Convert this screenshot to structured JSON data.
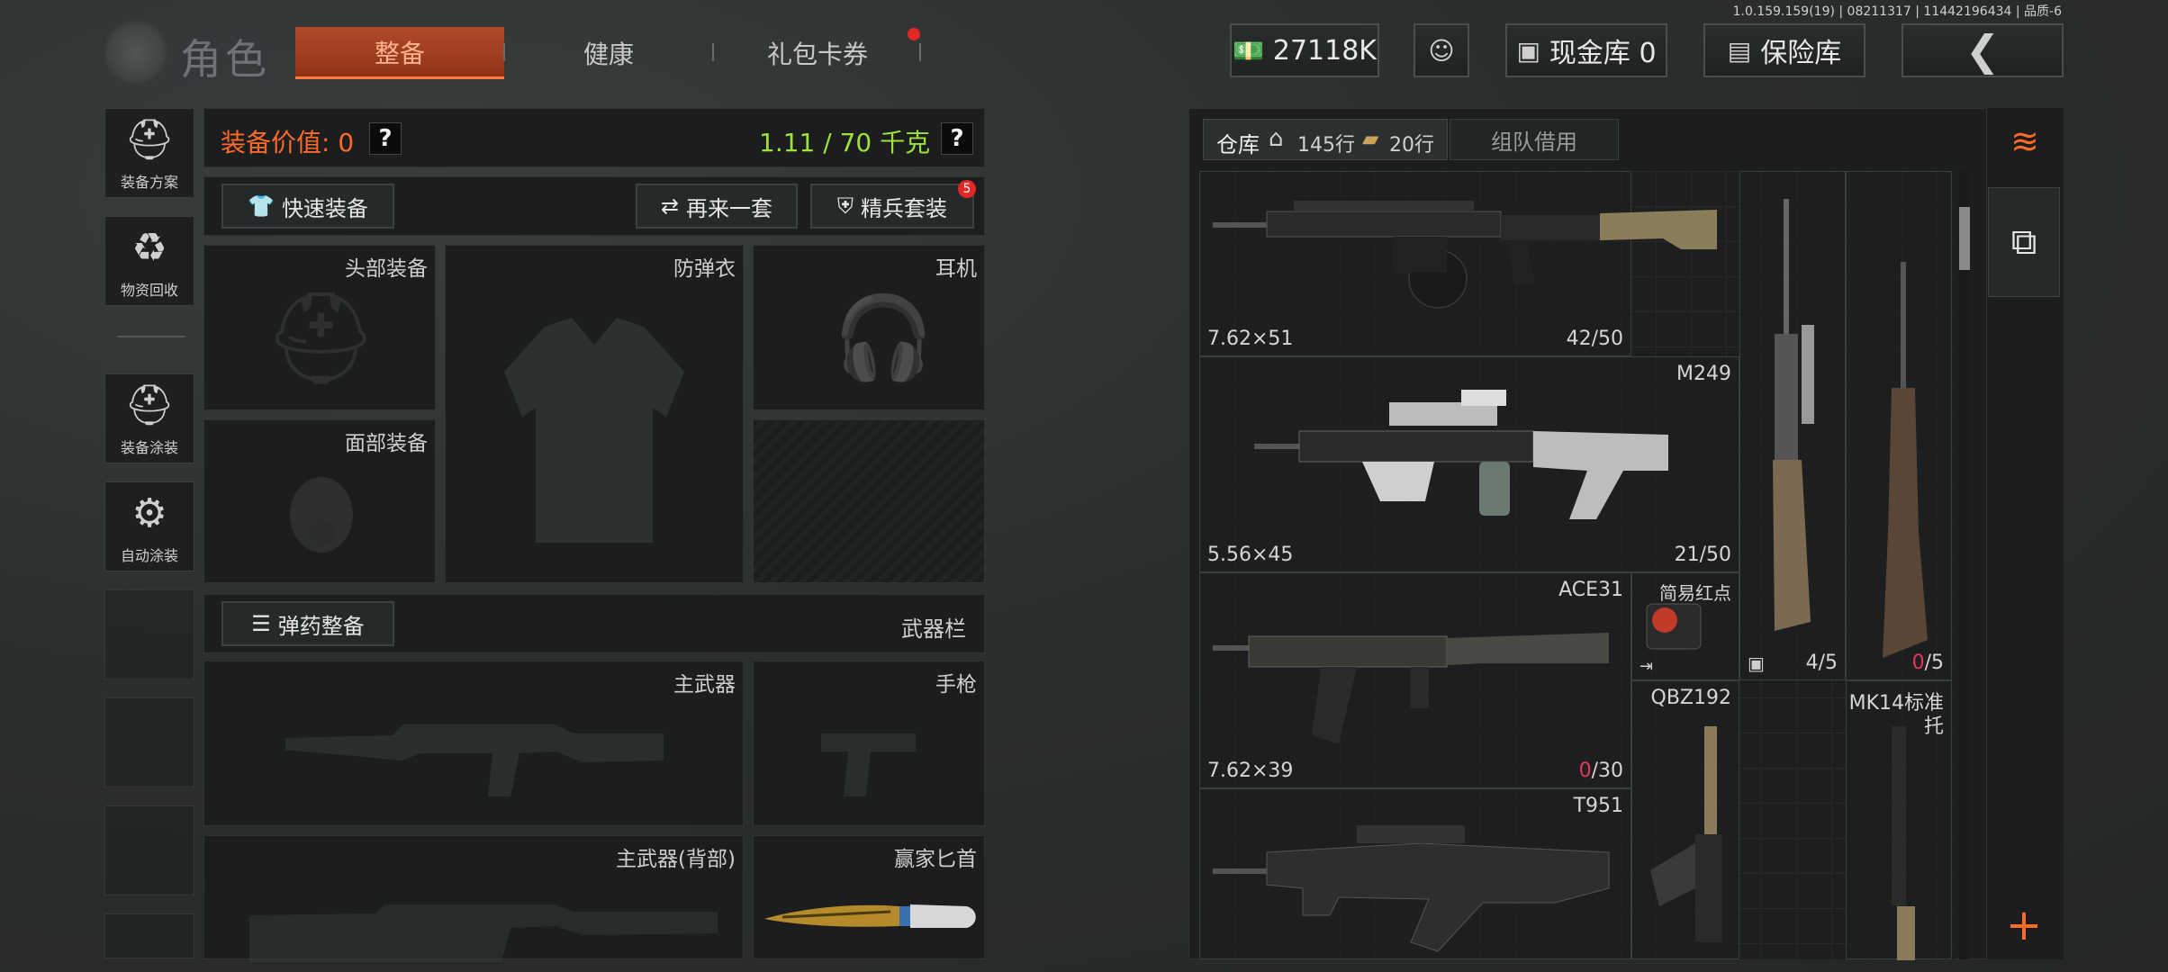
{
  "version": "1.0.159.159(19) | 08211317 | 11442196434 | 品质-6",
  "header": {
    "title": "角色",
    "tabs": [
      {
        "label": "整备",
        "active": true
      },
      {
        "label": "健康",
        "active": false
      },
      {
        "label": "礼包卡券",
        "active": false,
        "notification": true
      }
    ],
    "currency": "27118K",
    "cash_vault": "现金库 0",
    "safe_box": "保险库"
  },
  "sidebar": {
    "items": [
      {
        "label": "装备方案",
        "icon": "helmet-plan-icon"
      },
      {
        "label": "物资回收",
        "icon": "recycle-icon"
      },
      {
        "label": "装备涂装",
        "icon": "paint-armor-icon"
      },
      {
        "label": "自动涂装",
        "icon": "auto-paint-icon"
      }
    ]
  },
  "equipment": {
    "value_label": "装备价值: 0",
    "weight": "1.11 / 70 千克",
    "help": "?",
    "quick_equip": "快速装备",
    "again": "再来一套",
    "elite_set": "精兵套装",
    "elite_badge": "5",
    "slots": {
      "head": "头部装备",
      "armor": "防弹衣",
      "headset": "耳机",
      "face": "面部装备"
    },
    "ammo_button": "弹药整备",
    "weapon_bar": "武器栏",
    "weapon_slots": {
      "primary": "主武器",
      "pistol": "手枪",
      "primary_back": "主武器(背部)",
      "melee": "赢家匕首"
    }
  },
  "warehouse": {
    "tab_label": "仓库",
    "rows_house": "145行",
    "rows_extra": "20行",
    "team_borrow": "组队借用",
    "items": [
      {
        "name": "",
        "caliber": "7.62×51",
        "count": "42/50",
        "count_zero": false
      },
      {
        "name": "M249",
        "caliber": "5.56×45",
        "count": "21/50",
        "count_zero": false
      },
      {
        "name": "ACE31",
        "caliber": "7.62×39",
        "count_zero_part": "0",
        "count_rest": "/30",
        "count_zero": true
      },
      {
        "name": "简易红点",
        "caliber": "",
        "count": "",
        "count_zero": false
      },
      {
        "name": "",
        "caliber": "",
        "count": "4/5",
        "count_zero": false
      },
      {
        "name": "",
        "caliber": "",
        "count_zero_part": "0",
        "count_rest": "/5",
        "count_zero": true
      },
      {
        "name": "T951",
        "caliber": "",
        "count": "",
        "count_zero": false
      },
      {
        "name": "QBZ192",
        "caliber": "",
        "count": "",
        "count_zero": false
      },
      {
        "name": "MK14标准",
        "name2": "托",
        "caliber": "",
        "count": "",
        "count_zero": false
      }
    ]
  },
  "colors": {
    "accent_orange": "#ff6a2a",
    "weight_green": "#9fe03a",
    "danger_red": "#e8355a"
  }
}
